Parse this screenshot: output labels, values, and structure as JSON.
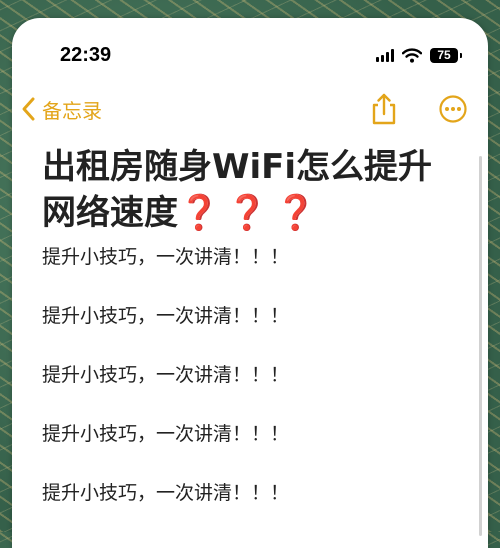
{
  "status_bar": {
    "time": "22:39",
    "battery": "75"
  },
  "nav": {
    "back_label": "备忘录"
  },
  "note": {
    "title_main": "出租房随身WiFi怎么提升网络速度",
    "title_marks": "❓❓❓",
    "lines": [
      "提升小技巧，一次讲清！！！",
      "提升小技巧，一次讲清！！！",
      "提升小技巧，一次讲清！！！",
      "提升小技巧，一次讲清！！！",
      "提升小技巧，一次讲清！！！"
    ]
  },
  "icons": {
    "back": "chevron-left-icon",
    "share": "share-icon",
    "more": "more-icon",
    "signal": "signal-icon",
    "wifi": "wifi-icon",
    "battery": "battery-icon"
  },
  "colors": {
    "accent": "#e3a51a",
    "question_mark": "#c8102e",
    "text": "#222222",
    "background_pattern": "#3f6e55"
  }
}
